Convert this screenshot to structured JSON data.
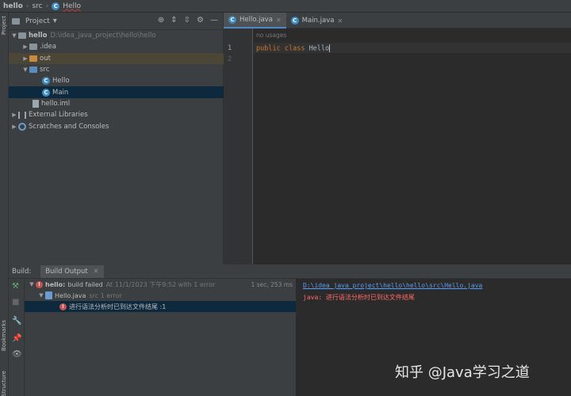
{
  "breadcrumb": {
    "project": "hello",
    "folder": "src",
    "file": "Hello"
  },
  "left_strip": {
    "project_label": "Project",
    "bookmarks_label": "Bookmarks",
    "structure_label": "Structure"
  },
  "project_panel": {
    "title": "Project",
    "tree": {
      "root": "hello",
      "root_path": "D:\\idea_java_project\\hello\\hello",
      "idea": ".idea",
      "out": "out",
      "src": "src",
      "hello_class": "Hello",
      "main_class": "Main",
      "iml": "hello.iml",
      "ext_libs": "External Libraries",
      "scratches": "Scratches and Consoles"
    }
  },
  "editor": {
    "tabs": [
      {
        "label": "Hello.java"
      },
      {
        "label": "Main.java"
      }
    ],
    "usages_hint": "no usages",
    "line_numbers": [
      "1",
      "2"
    ],
    "code": {
      "kw1": "public",
      "kw2": "class",
      "name": "Hello"
    }
  },
  "build": {
    "tab_build": "Build:",
    "tab_output": "Build Output",
    "tree": {
      "summary_name": "hello:",
      "summary_status": "build failed",
      "summary_time": "At 11/1/2023 下午9:52 with 1 error",
      "timing": "1 sec, 253 ms",
      "file": "Hello.java",
      "file_info": "src 1 error",
      "error_msg": "进行语法分析时已到达文件结尾 :1"
    },
    "output": {
      "path": "D:\\idea_java_project\\hello\\hello\\src\\Hello.java",
      "error": "java: 进行语法分析时已到达文件结尾"
    }
  },
  "watermark": "知乎 @Java学习之道",
  "colors": {
    "accent": "#4a88c7",
    "error": "#c75450",
    "keyword": "#cc7832",
    "link": "#589df6"
  }
}
